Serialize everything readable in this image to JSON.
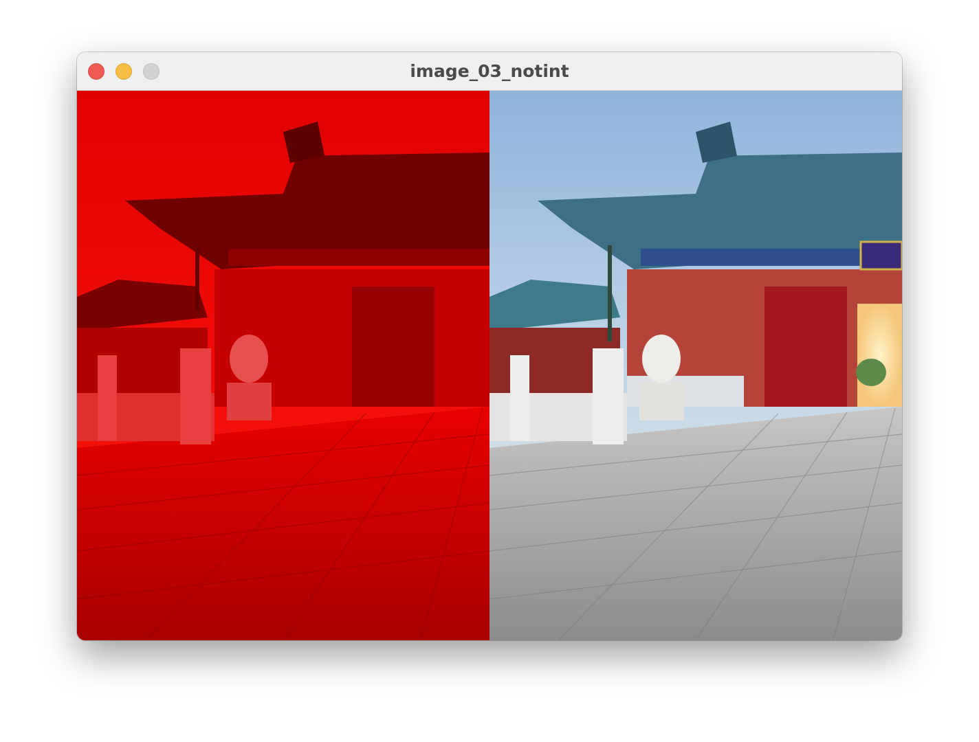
{
  "window": {
    "title": "image_03_notint",
    "traffic_lights": [
      "close",
      "minimize",
      "maximize"
    ]
  },
  "panels": [
    {
      "name": "red-channel-view",
      "tint": "#ff0000"
    },
    {
      "name": "original-view",
      "tint": "none"
    }
  ],
  "colors": {
    "titlebar": "#f0eff0",
    "close": "#ee5b52",
    "minimize": "#f5bd45",
    "maximize": "#d1d1d1"
  }
}
